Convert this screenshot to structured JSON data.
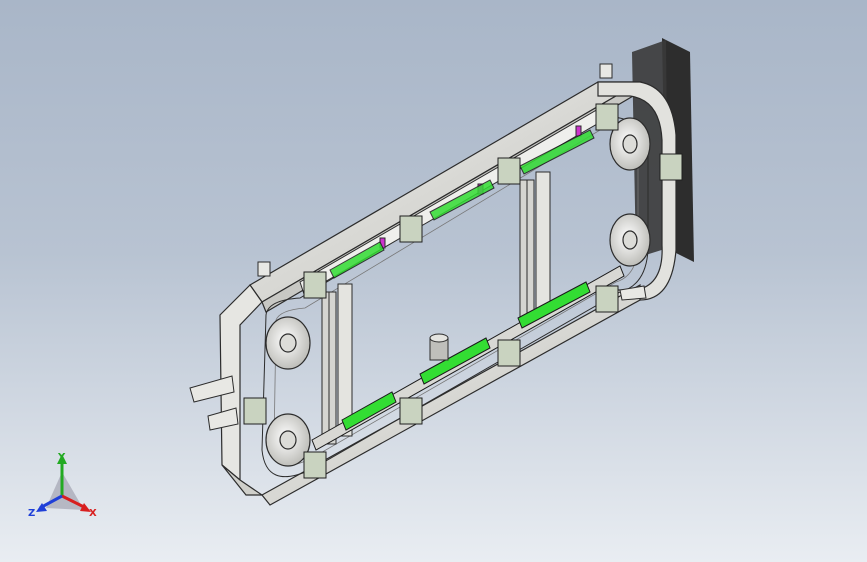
{
  "viewport": {
    "background_top": "#a9b6c8",
    "background_bottom": "#e9edf2"
  },
  "model": {
    "frame_color": "#dcdcd8",
    "frame_edge_color": "#2c2c2c",
    "plate_color": "#c9d3c0",
    "track_accent_color": "#33dd33",
    "pallet_accent_color": "#cc33cc"
  },
  "triad": {
    "x_label": "X",
    "y_label": "Y",
    "z_label": "Z",
    "x_color": "#d81f1f",
    "y_color": "#22aa22",
    "z_color": "#1f3fd8"
  }
}
